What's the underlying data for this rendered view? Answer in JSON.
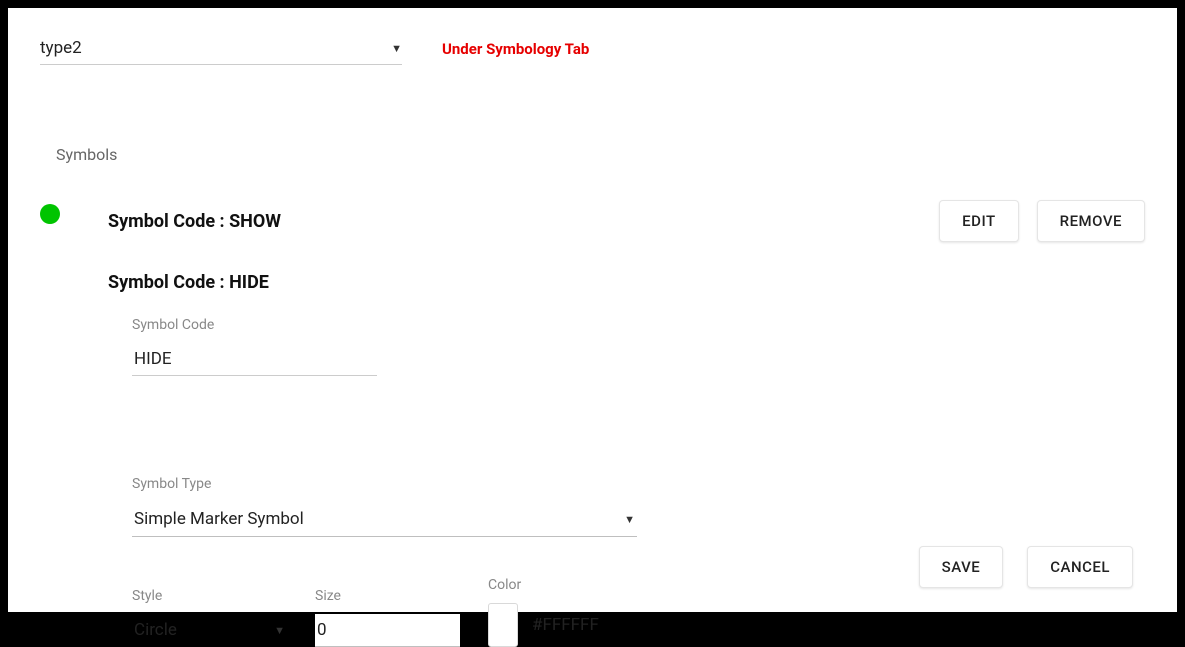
{
  "topSelect": {
    "value": "type2"
  },
  "tabNote": "Under Symbology Tab",
  "sectionLabel": "Symbols",
  "symbol1": {
    "label": "Symbol Code :",
    "value": "SHOW"
  },
  "symbol2": {
    "label": "Symbol Code :",
    "value": "HIDE"
  },
  "buttons": {
    "edit": "EDIT",
    "remove": "REMOVE",
    "save": "SAVE",
    "cancel": "CANCEL"
  },
  "fields": {
    "symbolCode": {
      "label": "Symbol Code",
      "value": "HIDE"
    },
    "symbolType": {
      "label": "Symbol Type",
      "value": "Simple Marker Symbol"
    },
    "style": {
      "label": "Style",
      "value": "Circle"
    },
    "size": {
      "label": "Size",
      "value": "0"
    },
    "color": {
      "label": "Color",
      "value": "#FFFFFF",
      "swatch": "#FFFFFF"
    }
  }
}
